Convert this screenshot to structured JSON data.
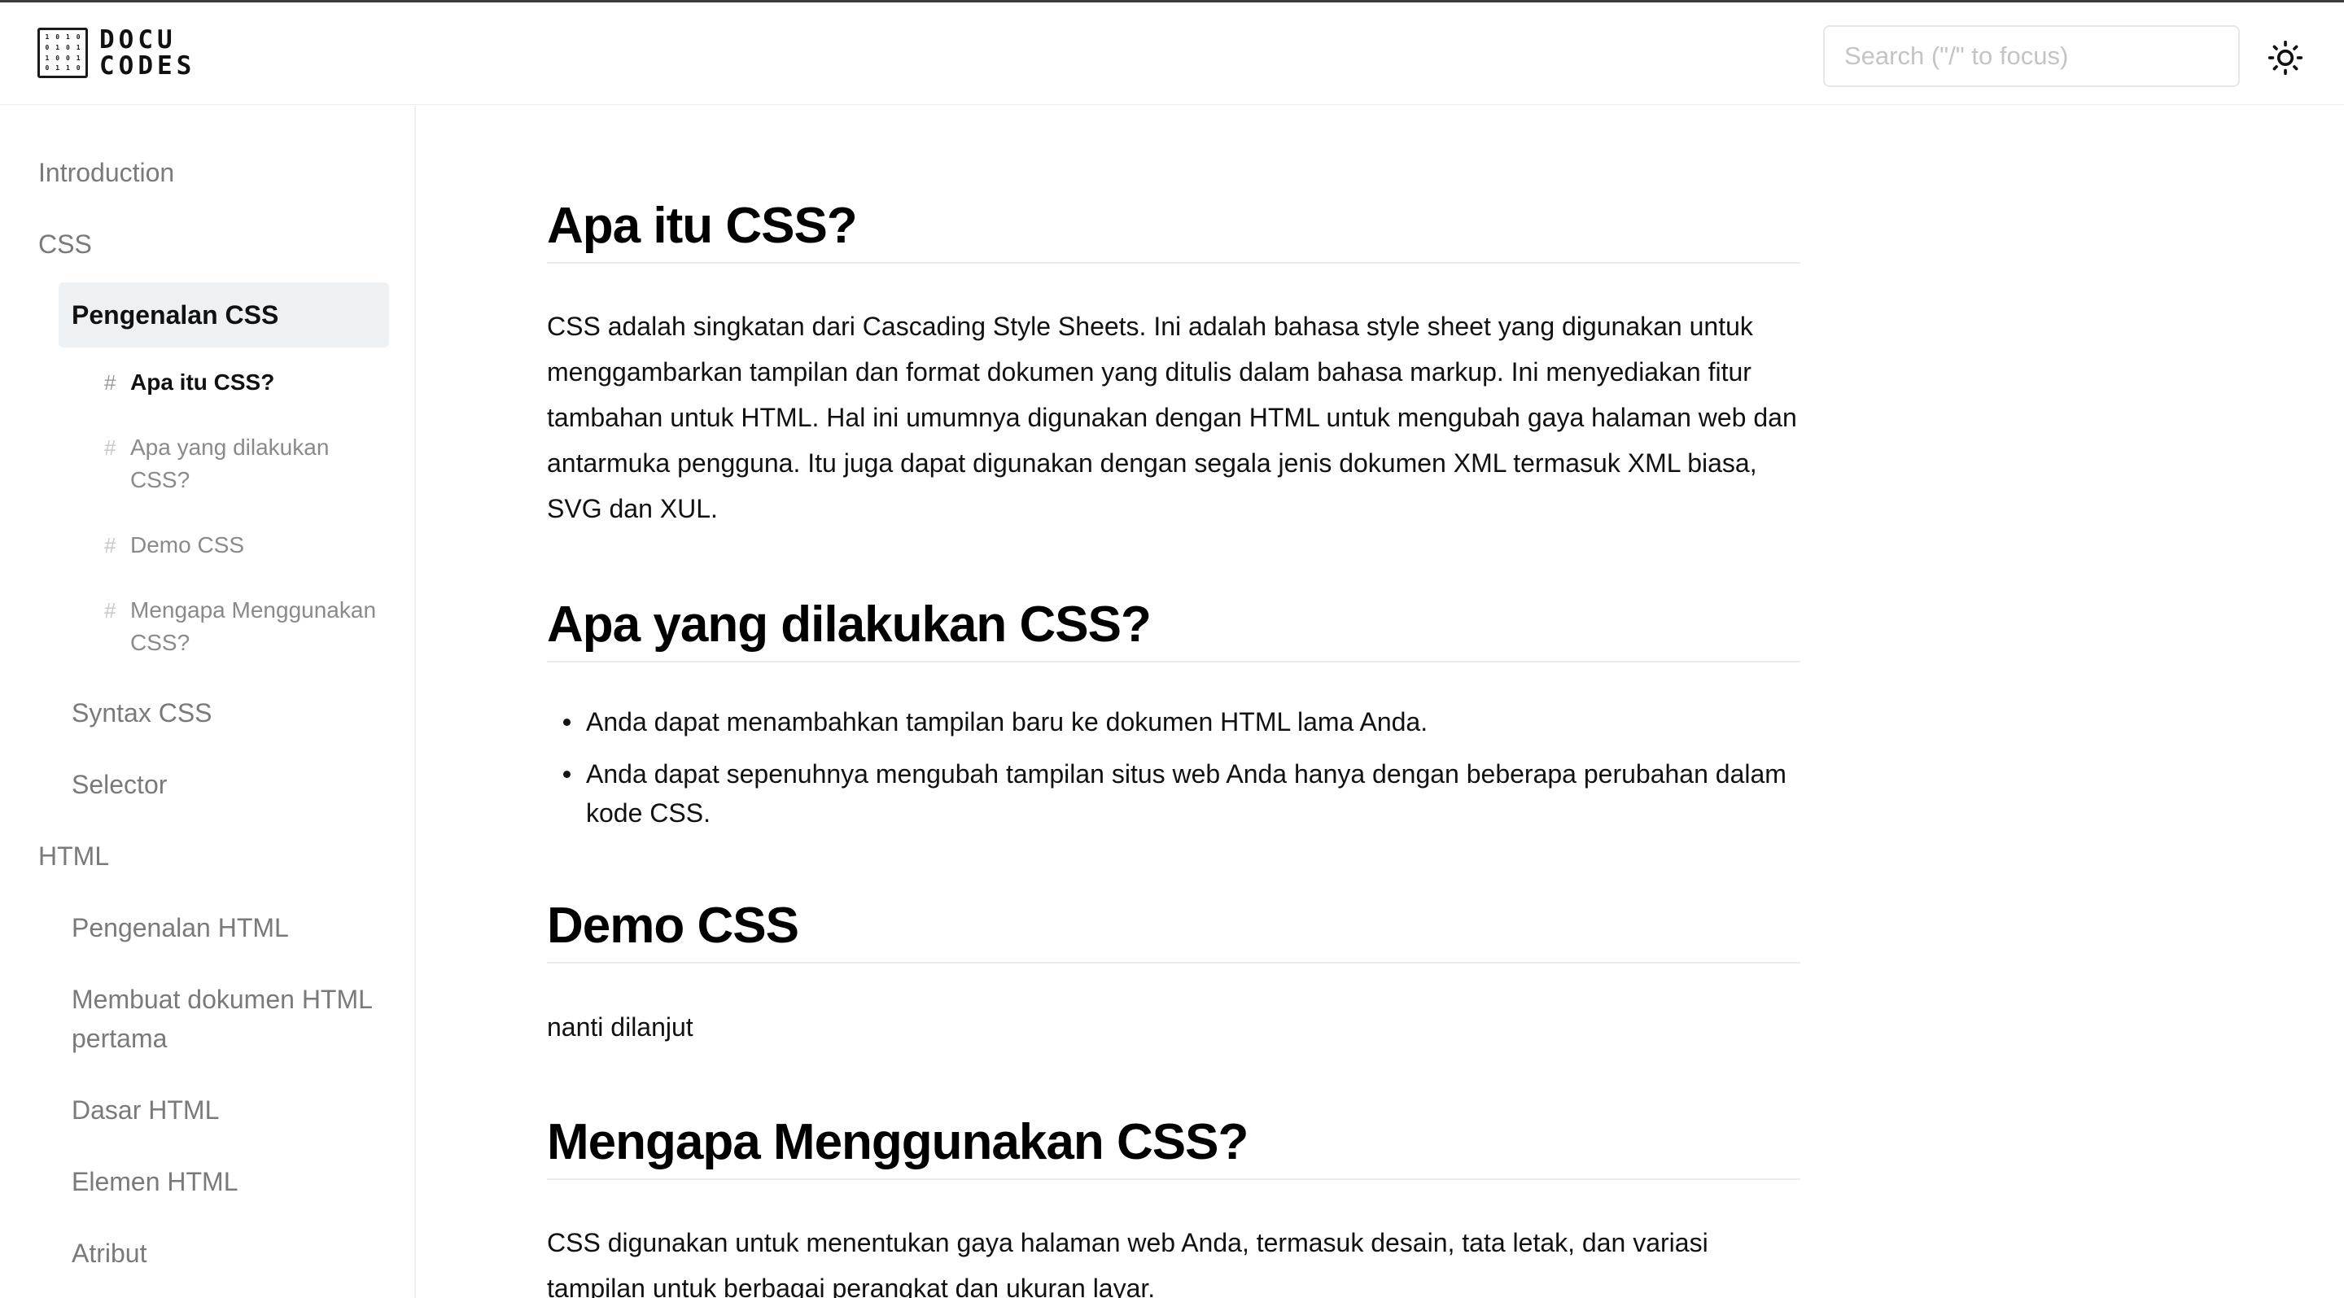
{
  "brand": {
    "logo_line1": "DOCU",
    "logo_line2": "CODES",
    "logo_bits": [
      "1",
      "0",
      "1",
      "0",
      "0",
      "1",
      "0",
      "1",
      "1",
      "0",
      "0",
      "1",
      "0",
      "1",
      "1",
      "0"
    ]
  },
  "header": {
    "search_placeholder": "Search (\"/\" to focus)",
    "theme_icon": "sun-icon"
  },
  "sidebar": {
    "items": [
      {
        "label": "Introduction"
      },
      {
        "label": "CSS"
      },
      {
        "label": "Pengenalan CSS",
        "active": true
      },
      {
        "label": "Syntax CSS"
      },
      {
        "label": "Selector"
      },
      {
        "label": "HTML"
      },
      {
        "label": "Pengenalan HTML"
      },
      {
        "label": "Membuat dokumen HTML pertama"
      },
      {
        "label": "Dasar HTML"
      },
      {
        "label": "Elemen HTML"
      },
      {
        "label": "Atribut"
      }
    ],
    "toc_hash": "#",
    "toc": [
      {
        "label": "Apa itu CSS?",
        "current": true
      },
      {
        "label": "Apa yang dilakukan CSS?"
      },
      {
        "label": "Demo CSS"
      },
      {
        "label": "Mengapa Menggunakan CSS?"
      }
    ]
  },
  "content": {
    "sections": [
      {
        "heading": "Apa itu CSS?",
        "paragraph": "CSS adalah singkatan dari Cascading Style Sheets. Ini adalah bahasa style sheet yang digunakan untuk menggambarkan tampilan dan format dokumen yang ditulis dalam bahasa markup. Ini menyediakan fitur tambahan untuk HTML. Hal ini umumnya digunakan dengan HTML untuk mengubah gaya halaman web dan antarmuka pengguna. Itu juga dapat digunakan dengan segala jenis dokumen XML termasuk XML biasa, SVG dan XUL."
      },
      {
        "heading": "Apa yang dilakukan CSS?",
        "bullets": [
          "Anda dapat menambahkan tampilan baru ke dokumen HTML lama Anda.",
          "Anda dapat sepenuhnya mengubah tampilan situs web Anda hanya dengan beberapa perubahan dalam kode CSS."
        ]
      },
      {
        "heading": "Demo CSS",
        "paragraph": "nanti dilanjut"
      },
      {
        "heading": "Mengapa Menggunakan CSS?",
        "paragraph": "CSS digunakan untuk menentukan gaya halaman web Anda, termasuk desain, tata letak, dan variasi tampilan untuk berbagai perangkat dan ukuran layar."
      }
    ]
  },
  "colors": {
    "active_bg": "#eef1f3",
    "muted_text": "#7a7a7a",
    "divider": "#ececec"
  }
}
